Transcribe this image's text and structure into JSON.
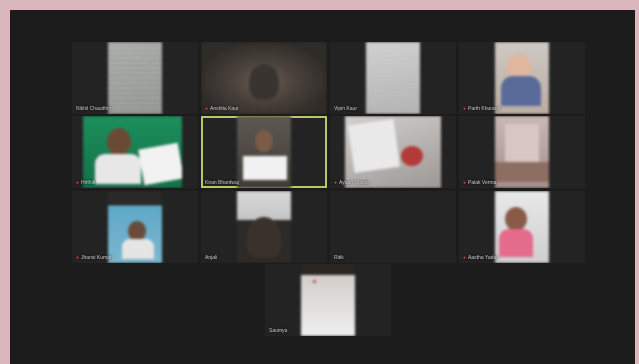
{
  "meeting": {
    "participants": [
      {
        "name": "Nikhil Chaudhry",
        "muted": false
      },
      {
        "name": "Anshita Kaur",
        "muted": true
      },
      {
        "name": "Vipin Kaur",
        "muted": false
      },
      {
        "name": "Parth Khurana",
        "muted": true
      },
      {
        "name": "Hrithik",
        "muted": true
      },
      {
        "name": "Kiran Bhardwaj",
        "muted": false
      },
      {
        "name": "Ayaan Srisod",
        "muted": true
      },
      {
        "name": "Palak Verma",
        "muted": true
      },
      {
        "name": "Jhansi Kumari",
        "muted": true
      },
      {
        "name": "Anjali",
        "muted": false
      },
      {
        "name": "Ritik",
        "muted": false
      },
      {
        "name": "Aastha Yadav",
        "muted": true
      },
      {
        "name": "Saumya",
        "muted": false
      }
    ]
  },
  "icons": {
    "muted": "mic-muted-icon"
  },
  "colors": {
    "active_speaker_border": "#b9c766",
    "muted_icon": "#e0403c"
  }
}
